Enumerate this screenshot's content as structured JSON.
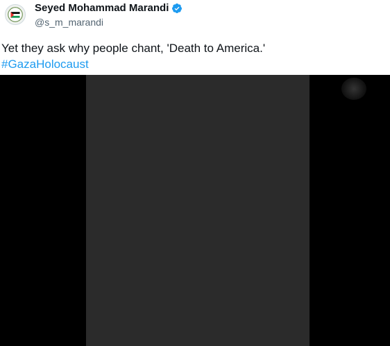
{
  "post": {
    "author": {
      "display_name": "Seyed Mohammad Marandi",
      "handle": "@s_m_marandi",
      "verified": true,
      "avatar_icon": "palestinian-flag-avatar-icon"
    },
    "text": "Yet they ask why people chant, 'Death to America.'",
    "hashtag": "#GazaHolocaust",
    "media": {
      "type": "video",
      "notice": ""
    }
  },
  "colors": {
    "text": "#0f1419",
    "secondary": "#536471",
    "link": "#1d9bf0",
    "verified": "#1d9bf0",
    "media_background": "#000000"
  }
}
